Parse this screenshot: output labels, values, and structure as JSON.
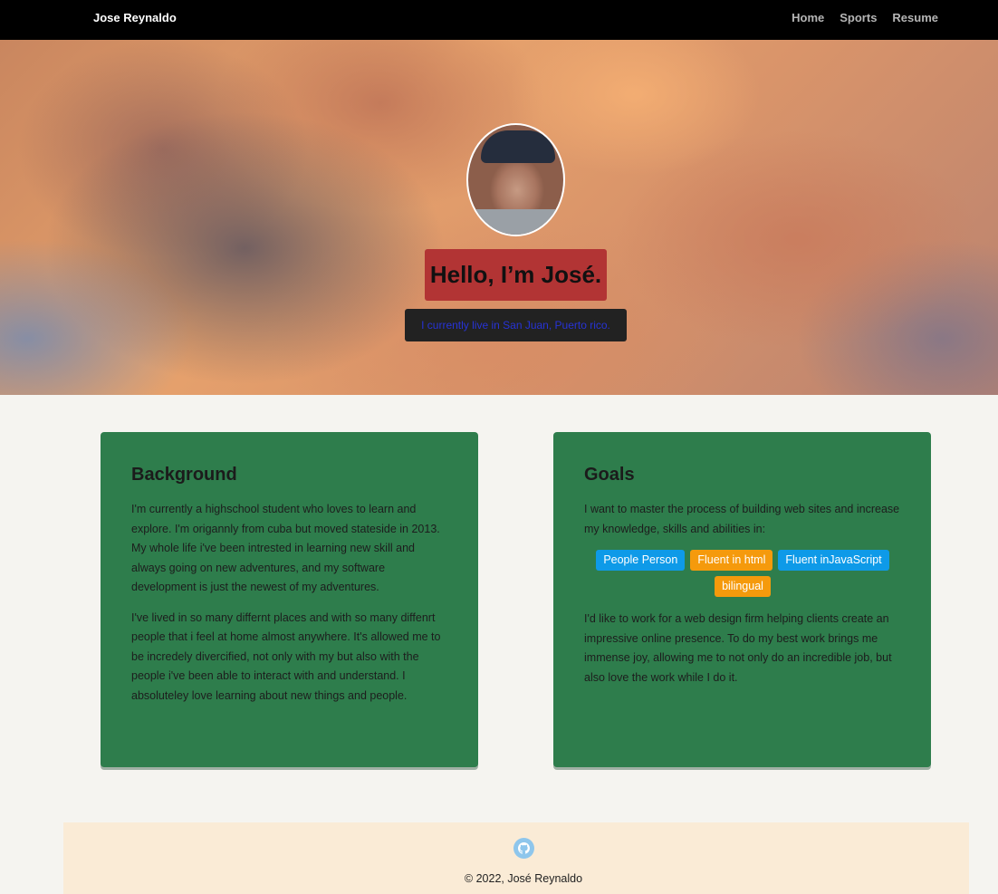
{
  "navbar": {
    "brand": "Jose Reynaldo",
    "links": [
      "Home",
      "Sports",
      "Resume"
    ]
  },
  "hero": {
    "title": "Hello, I’m José.",
    "subtitle": "I currently live in San Juan, Puerto rico."
  },
  "background_card": {
    "heading": "Background",
    "paragraphs": [
      "I'm currently a highschool student who loves to learn and explore. I'm origannly from cuba but moved stateside in 2013. My whole life i've been intrested in learning new skill and always going on new adventures, and my software development is just the newest of my adventures.",
      "I've lived in so many differnt places and with so many diffenrt people that i feel at home almost anywhere. It's allowed me to be incredely divercified, not only with my but also with the people i've been able to interact with and understand. I absoluteley love learning about new things and people."
    ]
  },
  "goals_card": {
    "heading": "Goals",
    "intro": "I want to master the process of building web sites and increase my knowledge, skills and abilities in:",
    "badges": [
      {
        "label": "People Person",
        "color": "#0e9ae8"
      },
      {
        "label": "Fluent in html",
        "color": "#f59a0c"
      },
      {
        "label": "Fluent inJavaScript",
        "color": "#0e9ae8"
      },
      {
        "label": "bilingual",
        "color": "#f59a0c"
      }
    ],
    "outro": "I'd like to work for a web design firm helping clients create an impressive online presence. To do my best work brings me immense joy, allowing me to not only do an incredible job, but also love the work while I do it."
  },
  "footer": {
    "icon": "github-icon",
    "copyright": "© 2022, José Reynaldo"
  },
  "colors": {
    "navbar": "#000000",
    "card": "#2e7d4c",
    "title_bg": "#b23434",
    "subtitle_text": "#2733d6",
    "footer_bg": "#faebd6"
  }
}
